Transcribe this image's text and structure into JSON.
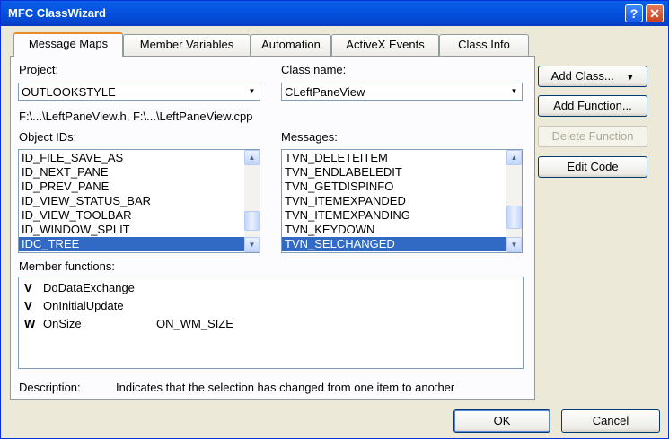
{
  "window": {
    "title": "MFC ClassWizard",
    "help_label": "?",
    "close_label": "✕"
  },
  "tabs": [
    {
      "label": "Message Maps",
      "active": true
    },
    {
      "label": "Member Variables"
    },
    {
      "label": "Automation"
    },
    {
      "label": "ActiveX Events"
    },
    {
      "label": "Class Info"
    }
  ],
  "project": {
    "label": "Project:",
    "value": "OUTLOOKSTYLE"
  },
  "classname": {
    "label": "Class name:",
    "value": "CLeftPaneView"
  },
  "files": "F:\\...\\LeftPaneView.h, F:\\...\\LeftPaneView.cpp",
  "object_ids": {
    "label": "Object IDs:",
    "items": [
      "ID_FILE_SAVE_AS",
      "ID_NEXT_PANE",
      "ID_PREV_PANE",
      "ID_VIEW_STATUS_BAR",
      "ID_VIEW_TOOLBAR",
      "ID_WINDOW_SPLIT",
      "IDC_TREE"
    ],
    "selected": "IDC_TREE"
  },
  "messages": {
    "label": "Messages:",
    "items": [
      "TVN_DELETEITEM",
      "TVN_ENDLABELEDIT",
      "TVN_GETDISPINFO",
      "TVN_ITEMEXPANDED",
      "TVN_ITEMEXPANDING",
      "TVN_KEYDOWN",
      "TVN_SELCHANGED"
    ],
    "selected": "TVN_SELCHANGED"
  },
  "member_functions": {
    "label": "Member functions:",
    "items": [
      {
        "prefix": "V",
        "name": "DoDataExchange",
        "message": ""
      },
      {
        "prefix": "V",
        "name": "OnInitialUpdate",
        "message": ""
      },
      {
        "prefix": "W",
        "name": "OnSize",
        "message": "ON_WM_SIZE"
      }
    ]
  },
  "description": {
    "label": "Description:",
    "text": "Indicates that the selection has changed from one item to another"
  },
  "buttons": {
    "add_class": "Add Class...",
    "add_class_arrow": "▼",
    "add_function": "Add Function...",
    "delete_function": "Delete Function",
    "edit_code": "Edit Code",
    "ok": "OK",
    "cancel": "Cancel"
  },
  "scroll_arrows": {
    "up": "▲",
    "down": "▼"
  },
  "colors": {
    "titlebar": "#0553e1",
    "selection": "#316ac5",
    "tab_highlight": "#e68b2c"
  }
}
